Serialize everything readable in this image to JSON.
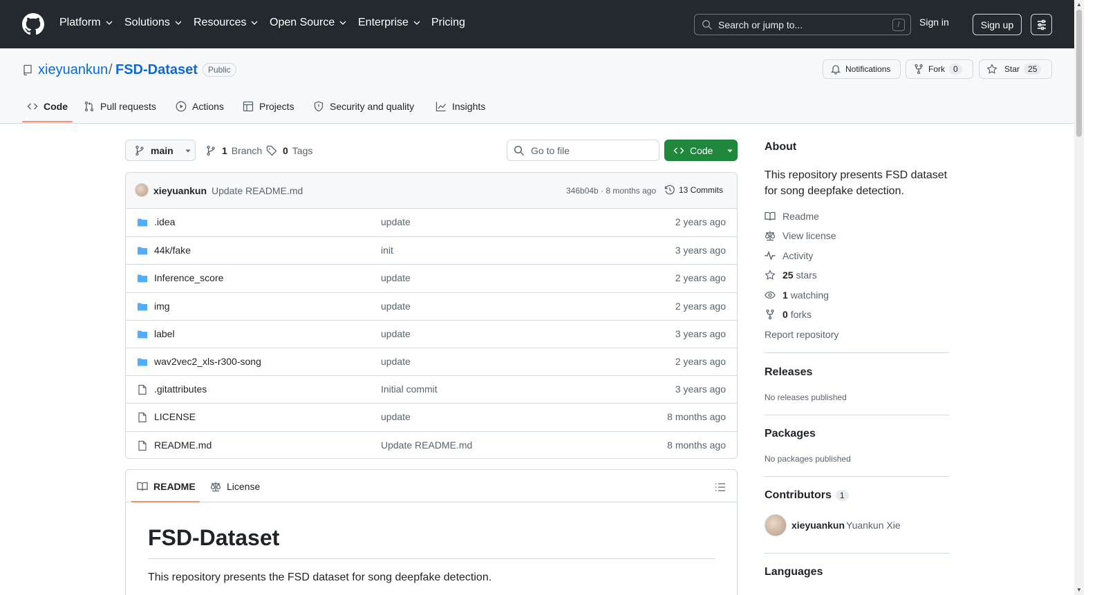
{
  "header": {
    "nav": [
      {
        "label": "Platform",
        "has_chevron": true
      },
      {
        "label": "Solutions",
        "has_chevron": true
      },
      {
        "label": "Resources",
        "has_chevron": true
      },
      {
        "label": "Open Source",
        "has_chevron": true
      },
      {
        "label": "Enterprise",
        "has_chevron": true
      },
      {
        "label": "Pricing",
        "has_chevron": false
      }
    ],
    "search_placeholder": "Search or jump to...",
    "search_shortcut": "/",
    "sign_in": "Sign in",
    "sign_up": "Sign up"
  },
  "repo": {
    "owner": "xieyuankun",
    "separator": "/",
    "name": "FSD-Dataset",
    "visibility": "Public",
    "notifications_label": "Notifications",
    "fork_label": "Fork",
    "fork_count": "0",
    "star_label": "Star",
    "star_count": "25"
  },
  "tabs": [
    {
      "label": "Code",
      "icon": "code-icon",
      "active": true
    },
    {
      "label": "Pull requests",
      "icon": "pull-request-icon"
    },
    {
      "label": "Actions",
      "icon": "play-icon"
    },
    {
      "label": "Projects",
      "icon": "table-icon"
    },
    {
      "label": "Security and quality",
      "icon": "shield-icon"
    },
    {
      "label": "Insights",
      "icon": "graph-icon"
    }
  ],
  "toolbar": {
    "branch": "main",
    "branch_count": "1",
    "branch_label": "Branch",
    "tag_count": "0",
    "tag_label": "Tags",
    "goto_placeholder": "Go to file",
    "code_button": "Code"
  },
  "commit": {
    "author": "xieyuankun",
    "message": "Update README.md",
    "hash_time": "346b04b · 8 months ago",
    "commits_label": "13 Commits"
  },
  "files": [
    {
      "name": ".idea",
      "type": "folder",
      "message": "update",
      "date": "2 years ago"
    },
    {
      "name": "44k/fake",
      "type": "folder",
      "message": "init",
      "date": "3 years ago"
    },
    {
      "name": "Inference_score",
      "type": "folder",
      "message": "update",
      "date": "2 years ago"
    },
    {
      "name": "img",
      "type": "folder",
      "message": "update",
      "date": "2 years ago"
    },
    {
      "name": "label",
      "type": "folder",
      "message": "update",
      "date": "3 years ago"
    },
    {
      "name": "wav2vec2_xls-r300-song",
      "type": "folder",
      "message": "update",
      "date": "2 years ago"
    },
    {
      "name": ".gitattributes",
      "type": "file",
      "message": "Initial commit",
      "date": "3 years ago"
    },
    {
      "name": "LICENSE",
      "type": "file",
      "message": "update",
      "date": "8 months ago"
    },
    {
      "name": "README.md",
      "type": "file",
      "message": "Update README.md",
      "date": "8 months ago"
    }
  ],
  "readme": {
    "tab_readme": "README",
    "tab_license": "License",
    "title": "FSD-Dataset",
    "intro": "This repository presents the FSD dataset for song deepfake detection."
  },
  "sidebar": {
    "about_heading": "About",
    "description": "This repository presents FSD dataset for song deepfake detection.",
    "readme": "Readme",
    "license": "View license",
    "activity": "Activity",
    "stars_count": "25",
    "stars_label": "stars",
    "watching_count": "1",
    "watching_label": "watching",
    "forks_count": "0",
    "forks_label": "forks",
    "report": "Report repository",
    "releases_heading": "Releases",
    "releases_text": "No releases published",
    "packages_heading": "Packages",
    "packages_text": "No packages published",
    "contributors_heading": "Contributors",
    "contributors_count": "1",
    "contributor_login": "xieyuankun",
    "contributor_name": "Yuankun Xie",
    "languages_heading": "Languages"
  },
  "colors": {
    "header_bg": "#24292f",
    "accent_green": "#1f883d",
    "link_blue": "#0969da",
    "folder_blue": "#54aeff",
    "tab_underline": "#fd8c73"
  }
}
